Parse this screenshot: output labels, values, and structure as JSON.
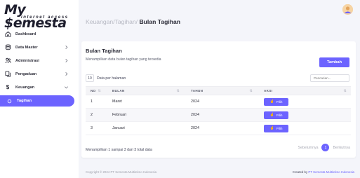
{
  "brand": {
    "name": "My Semesta",
    "tagline": "internet access"
  },
  "sidebar": {
    "items": [
      {
        "label": "Dashboard",
        "icon": "home-icon",
        "has_children": false,
        "active": false
      },
      {
        "label": "Data Master",
        "icon": "database-icon",
        "has_children": true,
        "active": false
      },
      {
        "label": "Administrasi",
        "icon": "users-icon",
        "has_children": true,
        "active": false
      },
      {
        "label": "Pengaduan",
        "icon": "copy-icon",
        "has_children": true,
        "active": false
      },
      {
        "label": "Keuangan",
        "icon": "dollar-icon",
        "has_children": true,
        "expanded": true,
        "active": false
      },
      {
        "label": "Tagihan",
        "icon": "circle-icon",
        "has_children": false,
        "active": true
      }
    ]
  },
  "breadcrumb": {
    "part1": "Keuangan/",
    "part2": "Tagihan/",
    "current": "Bulan Tagihan"
  },
  "card": {
    "title": "Bulan Tagihan",
    "subtitle": "Menampilkan data bulan tagihan yang tersedia",
    "add_button": "Tambah",
    "page_length": "10",
    "page_length_label": "Data per halaman",
    "search_placeholder": "Pencarian...",
    "columns": [
      "NO",
      "BULAN",
      "TAHUN",
      "AKSI"
    ],
    "rows": [
      {
        "no": "1",
        "bulan": "Maret",
        "tahun": "2024",
        "aksi": "Pilih"
      },
      {
        "no": "2",
        "bulan": "Februari",
        "tahun": "2024",
        "aksi": "Pilih"
      },
      {
        "no": "3",
        "bulan": "Januari",
        "tahun": "2024",
        "aksi": "Pilih"
      }
    ],
    "info": "Menampilkan 1 sampai 3 dari 3 total data",
    "pager": {
      "prev": "Sebelumnya",
      "current": "1",
      "next": "Berikutnya"
    }
  },
  "footer": {
    "copyright": "Copyright © 2024 PT Semesta Multitekno Indonesia",
    "created_prefix": "Created by ",
    "created_brand": "PT Semesta Multitekno Indonesia"
  },
  "colors": {
    "accent": "#6c63ff",
    "background": "#f4f5fa"
  }
}
